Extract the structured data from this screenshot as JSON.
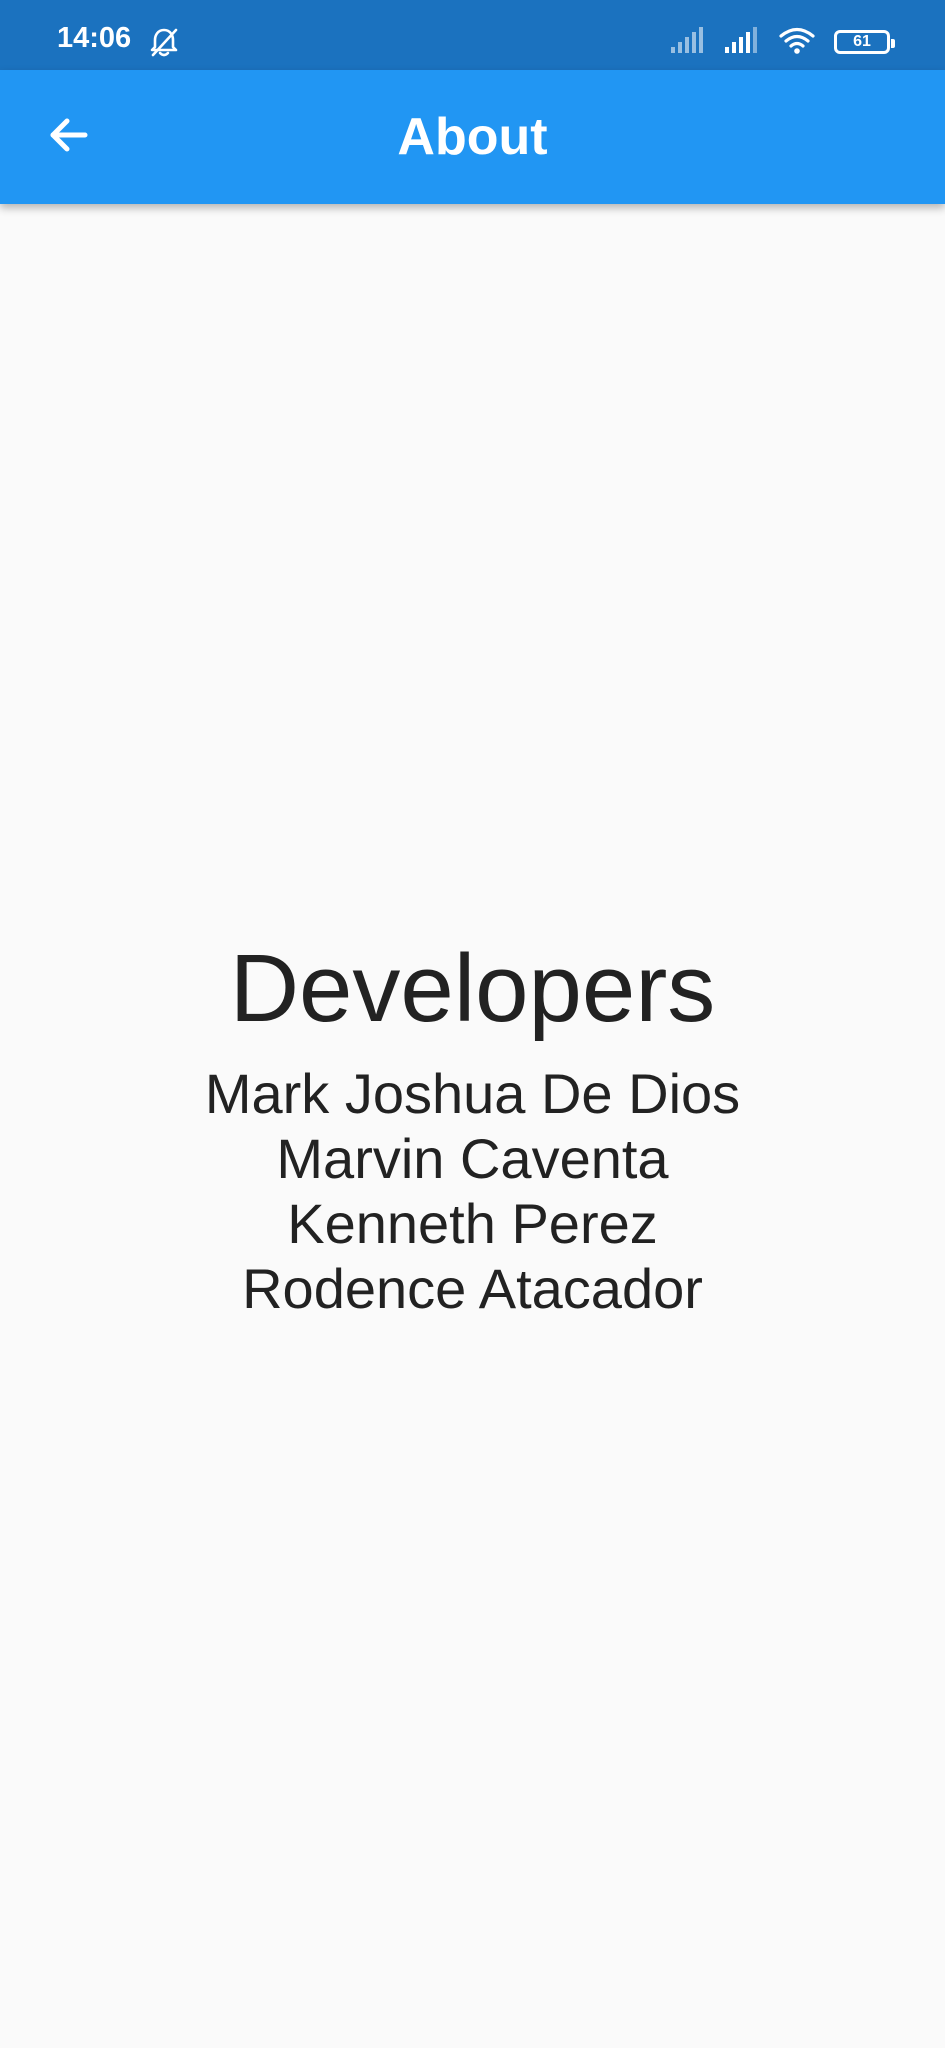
{
  "status_bar": {
    "time": "14:06",
    "left_icon": "notifications-off-icon",
    "battery_level": "61",
    "icons": [
      "signal-icon",
      "signal-icon",
      "wifi-icon",
      "battery-icon"
    ],
    "background_color": "#1b72bf"
  },
  "app_bar": {
    "title": "About",
    "back_icon": "arrow-back-icon",
    "background_color": "#2196f3"
  },
  "main": {
    "heading": "Developers",
    "developers": [
      "Mark Joshua De Dios",
      "Marvin Caventa",
      "Kenneth Perez",
      "Rodence Atacador"
    ]
  }
}
